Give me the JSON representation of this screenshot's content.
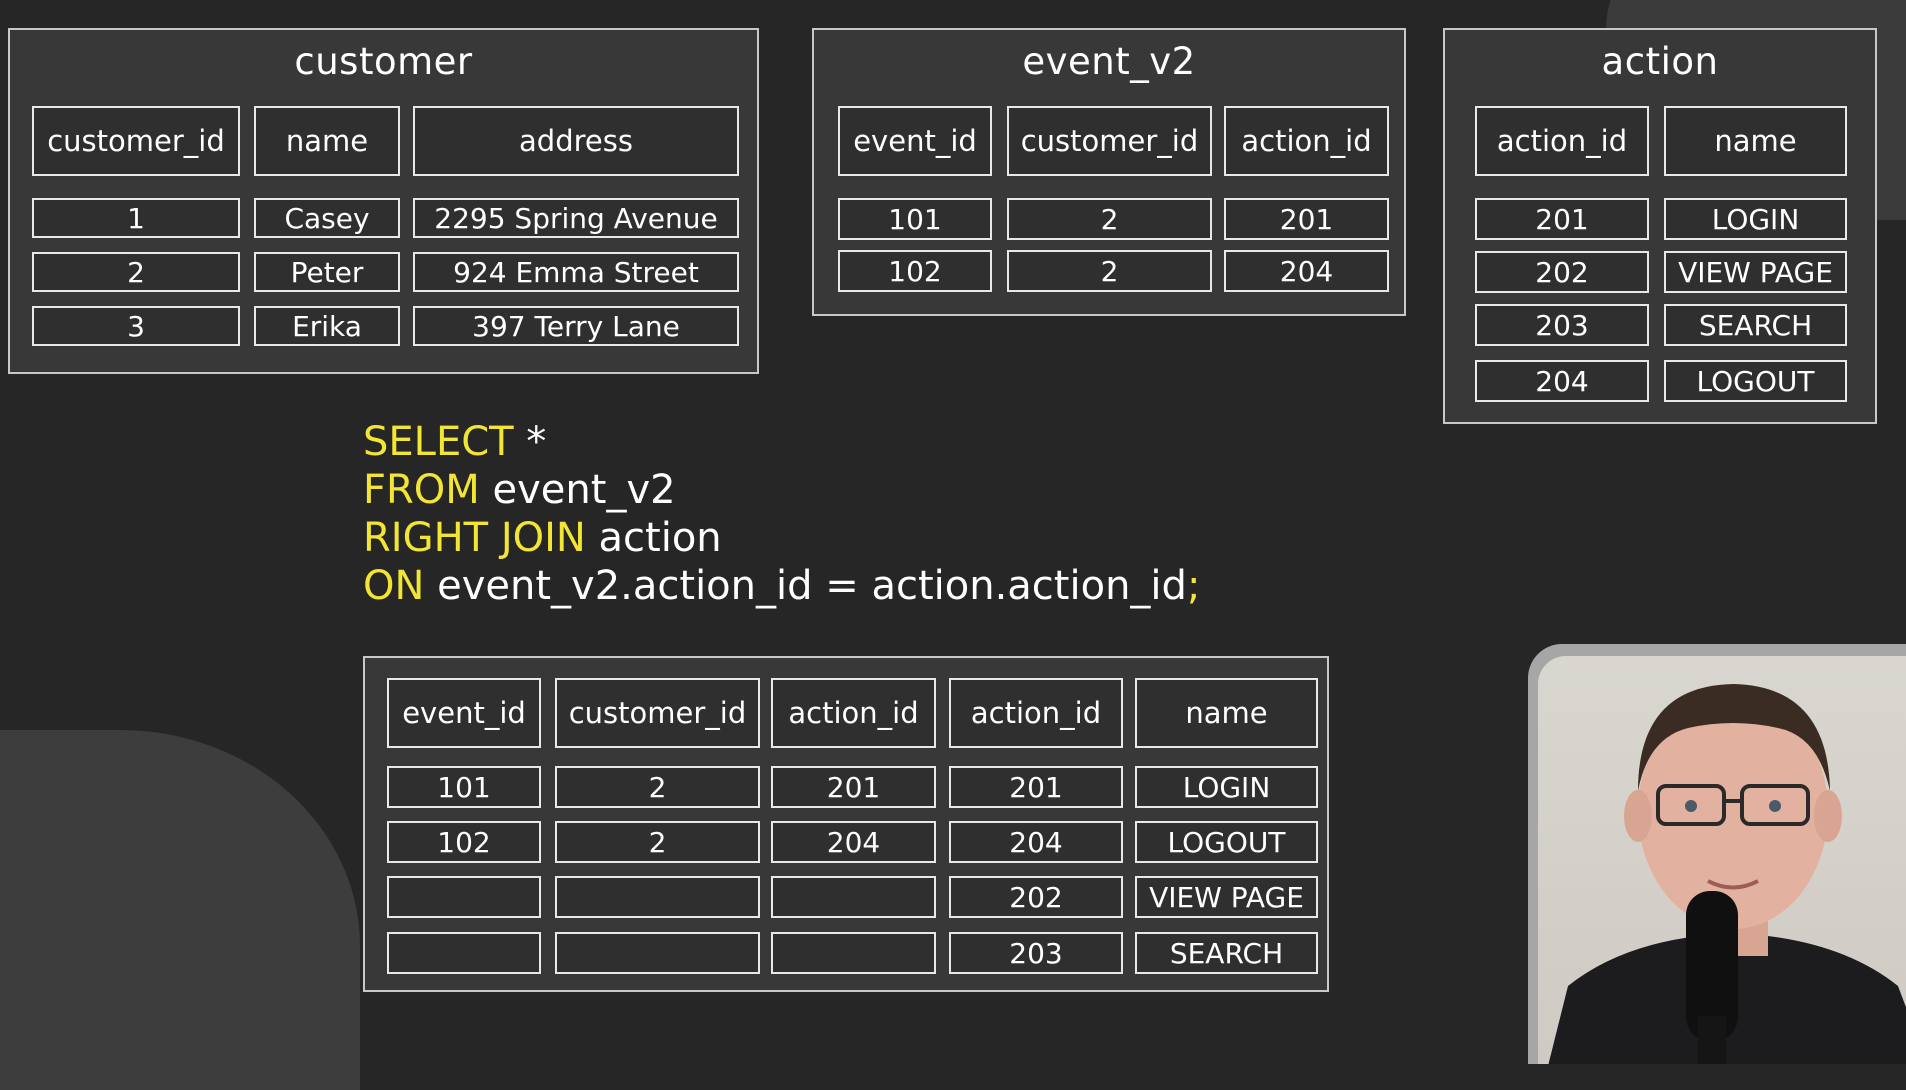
{
  "customer_table": {
    "title": "customer",
    "headers": [
      "customer_id",
      "name",
      "address"
    ],
    "rows": [
      [
        "1",
        "Casey",
        "2295 Spring Avenue"
      ],
      [
        "2",
        "Peter",
        "924 Emma Street"
      ],
      [
        "3",
        "Erika",
        "397 Terry Lane"
      ]
    ]
  },
  "event_table": {
    "title": "event_v2",
    "headers": [
      "event_id",
      "customer_id",
      "action_id"
    ],
    "rows": [
      [
        "101",
        "2",
        "201"
      ],
      [
        "102",
        "2",
        "204"
      ]
    ]
  },
  "action_table": {
    "title": "action",
    "headers": [
      "action_id",
      "name"
    ],
    "rows": [
      [
        "201",
        "LOGIN"
      ],
      [
        "202",
        "VIEW PAGE"
      ],
      [
        "203",
        "SEARCH"
      ],
      [
        "204",
        "LOGOUT"
      ]
    ]
  },
  "query": {
    "line1_kw": "SELECT",
    "line1_rest": " *",
    "line2_kw": "FROM",
    "line2_rest": " event_v2",
    "line3_kw": "RIGHT JOIN",
    "line3_rest": " action",
    "line4_kw": "ON",
    "line4_rest": " event_v2.action_id = action.action_id",
    "line4_end": ";"
  },
  "result_table": {
    "headers": [
      "event_id",
      "customer_id",
      "action_id",
      "action_id",
      "name"
    ],
    "rows": [
      [
        "101",
        "2",
        "201",
        "201",
        "LOGIN"
      ],
      [
        "102",
        "2",
        "204",
        "204",
        "LOGOUT"
      ],
      [
        "",
        "",
        "",
        "202",
        "VIEW PAGE"
      ],
      [
        "",
        "",
        "",
        "203",
        "SEARCH"
      ]
    ]
  },
  "colors": {
    "background": "#262626",
    "keyword": "#f2e533",
    "panel": "#383838",
    "border": "#e8e8e8"
  },
  "webcam": {
    "icon": "presenter-video"
  }
}
